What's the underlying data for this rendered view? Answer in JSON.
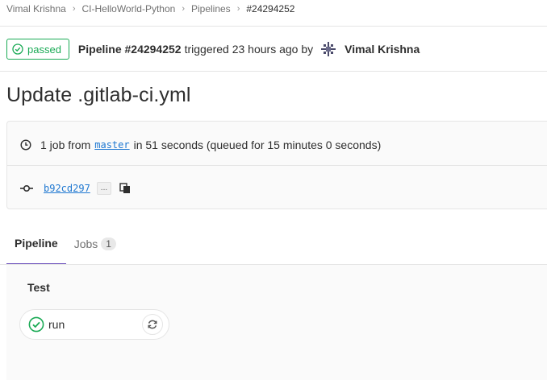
{
  "breadcrumb": {
    "items": [
      "Vimal Krishna",
      "CI-HelloWorld-Python",
      "Pipelines"
    ],
    "current": "#24294252"
  },
  "header": {
    "status_label": "passed",
    "pipeline_label": "Pipeline #24294252",
    "triggered_text": "triggered 23 hours ago by",
    "author": "Vimal Krishna"
  },
  "title": "Update .gitlab-ci.yml",
  "info": {
    "jobs_prefix": "1 job from",
    "branch": "master",
    "duration_text": "in 51 seconds (queued for 15 minutes 0 seconds)",
    "commit_sha": "b92cd297",
    "ellipsis": "..."
  },
  "tabs": [
    {
      "label": "Pipeline",
      "active": true
    },
    {
      "label": "Jobs",
      "count": "1"
    }
  ],
  "graph": {
    "stage_title": "Test",
    "job": {
      "name": "run",
      "status": "success"
    }
  },
  "icons": {
    "status": "check-circle-icon",
    "clock": "clock-icon",
    "commit": "commit-icon",
    "copy": "copy-icon",
    "retry": "retry-icon",
    "avatar": "avatar"
  },
  "colors": {
    "success": "#1aaa55",
    "link": "#1f78d1",
    "active_tab": "#6b4fbb"
  }
}
